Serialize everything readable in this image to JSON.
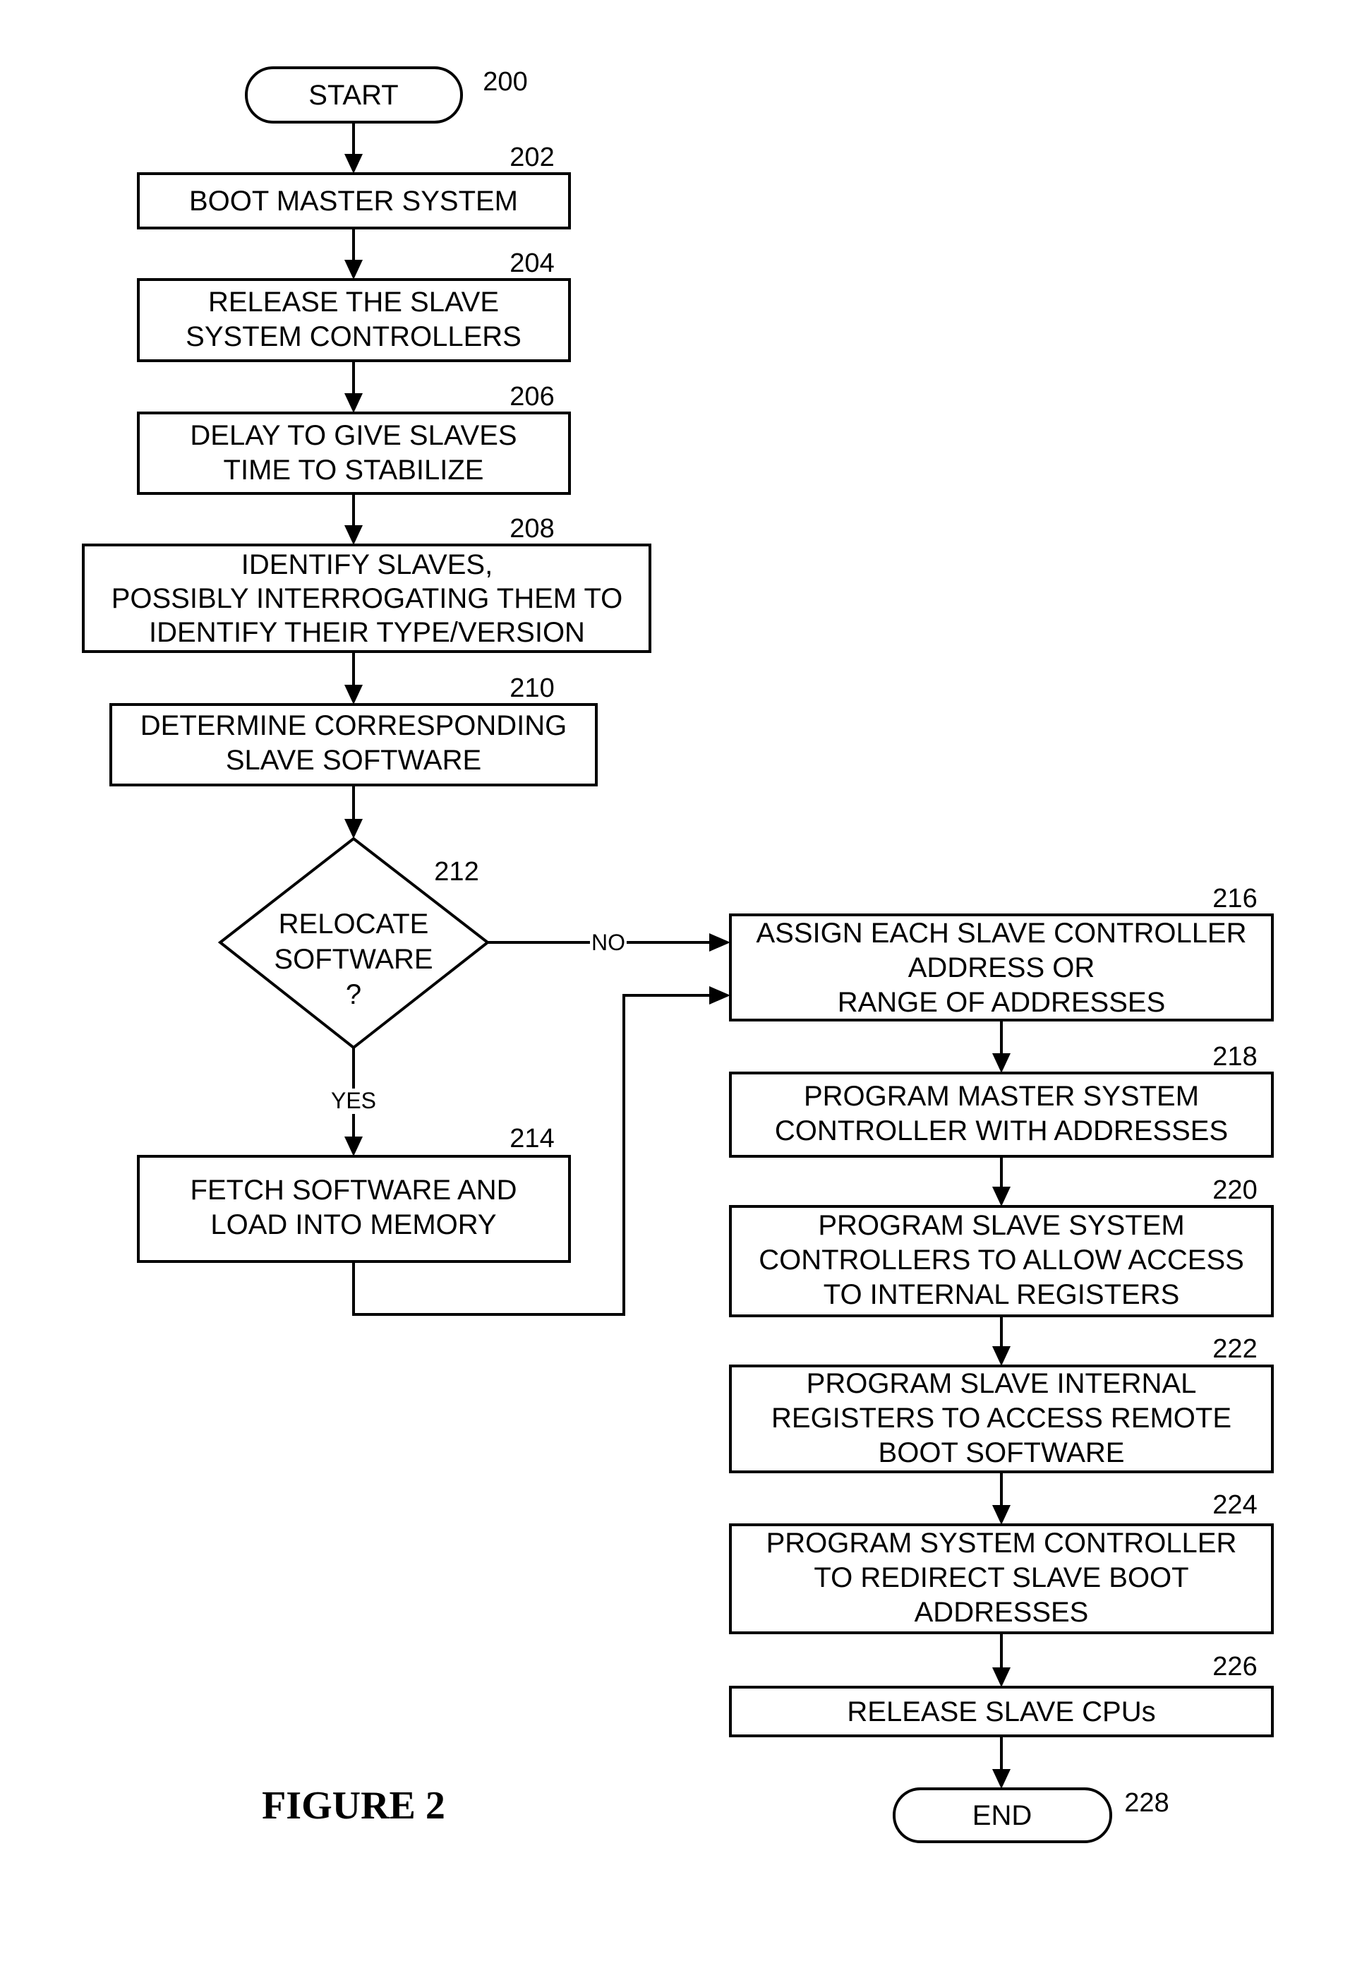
{
  "figure_caption": "FIGURE 2",
  "nodes": {
    "n200": {
      "ref": "200",
      "lines": [
        "START"
      ]
    },
    "n202": {
      "ref": "202",
      "lines": [
        "BOOT MASTER SYSTEM"
      ]
    },
    "n204": {
      "ref": "204",
      "lines": [
        "RELEASE THE SLAVE",
        "SYSTEM CONTROLLERS"
      ]
    },
    "n206": {
      "ref": "206",
      "lines": [
        "DELAY TO GIVE SLAVES",
        "TIME TO STABILIZE"
      ]
    },
    "n208": {
      "ref": "208",
      "lines": [
        "IDENTIFY SLAVES,",
        "POSSIBLY INTERROGATING THEM TO",
        "IDENTIFY THEIR TYPE/VERSION"
      ]
    },
    "n210": {
      "ref": "210",
      "lines": [
        "DETERMINE CORRESPONDING",
        "SLAVE SOFTWARE"
      ]
    },
    "n212": {
      "ref": "212",
      "lines": [
        "RELOCATE",
        "SOFTWARE",
        "?"
      ]
    },
    "n214": {
      "ref": "214",
      "lines": [
        "FETCH SOFTWARE AND",
        "LOAD INTO MEMORY"
      ]
    },
    "n216": {
      "ref": "216",
      "lines": [
        "ASSIGN EACH SLAVE CONTROLLER",
        "ADDRESS OR",
        "RANGE OF ADDRESSES"
      ]
    },
    "n218": {
      "ref": "218",
      "lines": [
        "PROGRAM MASTER SYSTEM",
        "CONTROLLER WITH ADDRESSES"
      ]
    },
    "n220": {
      "ref": "220",
      "lines": [
        "PROGRAM SLAVE SYSTEM",
        "CONTROLLERS TO ALLOW ACCESS",
        "TO INTERNAL REGISTERS"
      ]
    },
    "n222": {
      "ref": "222",
      "lines": [
        "PROGRAM SLAVE INTERNAL",
        "REGISTERS TO ACCESS REMOTE",
        "BOOT SOFTWARE"
      ]
    },
    "n224": {
      "ref": "224",
      "lines": [
        "PROGRAM SYSTEM CONTROLLER",
        "TO REDIRECT SLAVE BOOT",
        "ADDRESSES"
      ]
    },
    "n226": {
      "ref": "226",
      "lines": [
        "RELEASE SLAVE CPUs"
      ]
    },
    "n228": {
      "ref": "228",
      "lines": [
        "END"
      ]
    }
  },
  "edge_labels": {
    "no": "NO",
    "yes": "YES"
  }
}
